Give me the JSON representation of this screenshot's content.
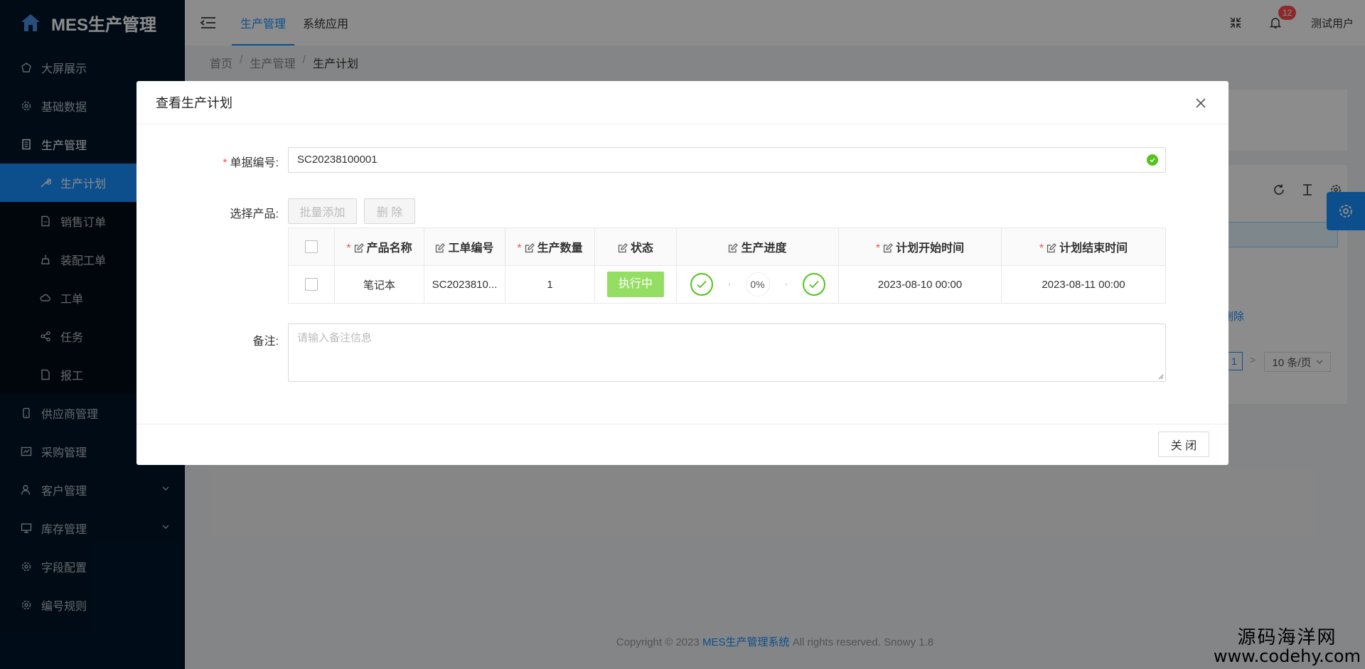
{
  "app": {
    "title": "MES生产管理"
  },
  "sidebar": {
    "items": [
      {
        "label": "大屏展示",
        "icon": "dashboard-icon"
      },
      {
        "label": "基础数据",
        "icon": "gear-icon"
      },
      {
        "label": "生产管理",
        "icon": "document-icon",
        "expanded": true
      }
    ],
    "sub_items": [
      {
        "label": "生产计划",
        "icon": "wrench-icon",
        "active": true
      },
      {
        "label": "销售订单",
        "icon": "file-icon"
      },
      {
        "label": "装配工单",
        "icon": "clean-icon"
      },
      {
        "label": "工单",
        "icon": "cloud-icon"
      },
      {
        "label": "任务",
        "icon": "share-icon"
      },
      {
        "label": "报工",
        "icon": "file-icon"
      }
    ],
    "items_after": [
      {
        "label": "供应商管理",
        "icon": "phone-icon"
      },
      {
        "label": "采购管理",
        "icon": "chart-icon"
      },
      {
        "label": "客户管理",
        "icon": "user-icon",
        "has_arrow": true
      },
      {
        "label": "库存管理",
        "icon": "monitor-icon",
        "has_arrow": true
      },
      {
        "label": "字段配置",
        "icon": "gear-icon"
      },
      {
        "label": "编号规则",
        "icon": "gear-icon"
      }
    ]
  },
  "header": {
    "tabs": [
      {
        "label": "生产管理",
        "active": true
      },
      {
        "label": "系统应用"
      }
    ],
    "notification_count": "12",
    "user": "测试用户"
  },
  "breadcrumb": {
    "home": "首页",
    "section": "生产管理",
    "current": "生产计划",
    "sep": "/"
  },
  "background": {
    "delete_link": "删除",
    "pager_page": "1",
    "pager_next": ">",
    "pager_size": "10 条/页"
  },
  "modal": {
    "title": "查看生产计划",
    "code_label": "单据编号:",
    "code_value": "SC20238100001",
    "product_label": "选择产品:",
    "batch_add": "批量添加",
    "delete": "删 除",
    "columns": [
      "产品名称",
      "工单编号",
      "生产数量",
      "状态",
      "生产进度",
      "计划开始时间",
      "计划结束时间"
    ],
    "rows": [
      {
        "product": "笔记本",
        "work_order": "SC2023810...",
        "quantity": "1",
        "status": "执行中",
        "progress": "0%",
        "start": "2023-08-10 00:00",
        "end": "2023-08-11 00:00"
      }
    ],
    "remark_label": "备注:",
    "remark_placeholder": "请输入备注信息",
    "close": "关 闭"
  },
  "footer": {
    "prefix": "Copyright © 2023",
    "system": "MES生产管理系统",
    "suffix": "All rights reserved. Snowy 1.8"
  },
  "watermark": {
    "cn": "源码海洋网",
    "url": "www.codehy.com"
  },
  "colors": {
    "primary": "#1890ff",
    "sidebar_bg": "#001529",
    "success": "#52c41a",
    "status_bg": "#95de64",
    "danger": "#ff4d4f"
  }
}
